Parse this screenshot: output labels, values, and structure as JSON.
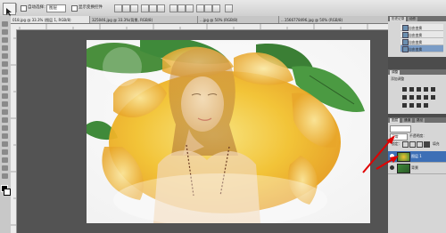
{
  "options_bar": {
    "auto_select_label": "自动选择：",
    "auto_select_value": "图层",
    "show_transform_label": "显示变换控件"
  },
  "tabs": [
    {
      "label": "018.jpg @ 33.3% (图层 1, RGB/8)"
    },
    {
      "label": "325046.jpg @ 33.3%(背景, RGB/8)"
    },
    {
      "label": "...jpg @ 50% (RGB/8)"
    },
    {
      "label": "...1566778496.jpg @ 50% (RGB/8)"
    }
  ],
  "panels": {
    "history": {
      "tabs": [
        "历史记录",
        "动作"
      ],
      "items": [
        {
          "label": "自由变换"
        },
        {
          "label": "自由变换"
        },
        {
          "label": "自由变换"
        },
        {
          "label": "自由变换"
        }
      ]
    },
    "adjustments": {
      "tabs": [
        "调整"
      ],
      "title": "添加调整"
    },
    "layers": {
      "tabs": [
        "图层",
        "通道",
        "路径"
      ],
      "blend_mode": "正常",
      "opacity_label": "不透明度：",
      "lock_label": "锁定：",
      "fill_label": "填充",
      "layers": [
        {
          "name": "图层 1",
          "selected": true
        },
        {
          "name": "背景",
          "selected": false
        }
      ]
    }
  },
  "colors": {
    "workspace": "#535353",
    "panel_bg": "#d6d6d6",
    "selected_layer": "#3d6fb6",
    "annotation_arrow": "#e00000",
    "rose_yellow": "#f2c12e",
    "leaf_green": "#3f8a3a"
  },
  "icons": [
    "move-tool-icon",
    "eye-icon",
    "red-arrow-annotation"
  ]
}
